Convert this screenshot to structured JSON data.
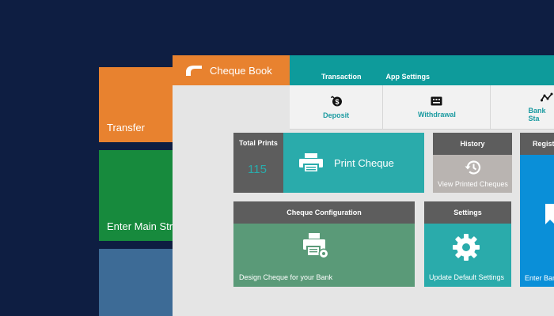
{
  "background_tiles": {
    "transfer": "Transfer",
    "enter_main": "Enter Main Stre"
  },
  "app": {
    "brand": "Cheque Book",
    "tabs": [
      "Transaction",
      "App Settings"
    ],
    "ribbon": {
      "deposit": "Deposit",
      "withdrawal": "Withdrawal",
      "bank": "Bank Sta"
    }
  },
  "dashboard": {
    "total_prints_label": "Total Prints",
    "total_prints_value": "115",
    "print_cheque": "Print Cheque",
    "history_title": "History",
    "history_caption": "View Printed Cheques",
    "register_title": "Registe",
    "config_title": "Cheque Configuration",
    "config_caption": "Design Cheque for your Bank",
    "settings_title": "Settings",
    "settings_caption": "Update Default Settings",
    "register_caption": "Enter Ban"
  },
  "colors": {
    "orange": "#e8822f",
    "teal": "#0e9b9b",
    "teal_tile": "#2aabab",
    "green_tile": "#5a9a78",
    "blue_tile": "#0a8fd8",
    "gray_header": "#5d5d5d",
    "dark_bg": "#0e1e42"
  }
}
